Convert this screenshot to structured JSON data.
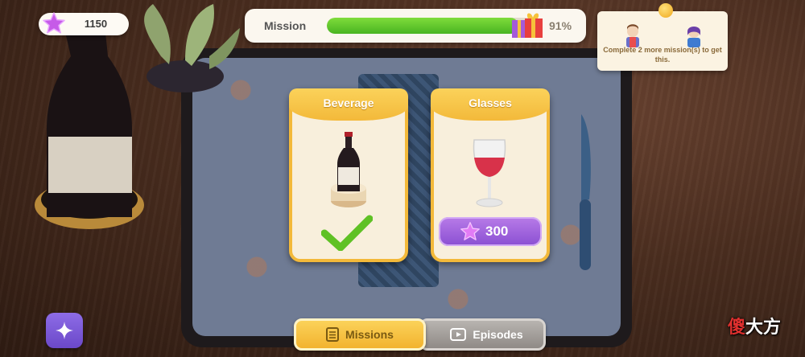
{
  "currency": {
    "value": "1150",
    "icon": "purple-star-icon"
  },
  "mission": {
    "label": "Mission",
    "progress_percent_text": "91%",
    "progress": 0.91
  },
  "reward_panel": {
    "text": "Complete 2 more mission(s) to get this."
  },
  "cards": [
    {
      "title": "Beverage",
      "item": "wine-bottle-icon",
      "status": "completed"
    },
    {
      "title": "Glasses",
      "item": "wine-glass-icon",
      "price": "300"
    }
  ],
  "tabs": {
    "missions": "Missions",
    "episodes": "Episodes"
  },
  "watermark": {
    "first": "傻",
    "rest": "大方"
  },
  "colors": {
    "accent_gold": "#f3b93a",
    "progress_green": "#49b421",
    "purple": "#8a4fd2"
  }
}
